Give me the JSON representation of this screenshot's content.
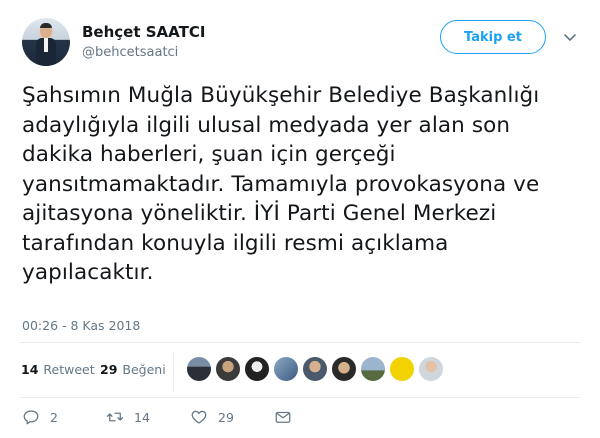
{
  "user": {
    "display_name": "Behçet SAATCI",
    "handle": "@behcetsaatci"
  },
  "follow_button": {
    "label": "Takip et"
  },
  "menu": {
    "icon": "chevron-down-icon"
  },
  "tweet": {
    "text": "Şahsımın Muğla Büyükşehir Belediye Başkanlığı adaylığıyla ilgili ulusal medyada yer alan son dakika haberleri, şuan için gerçeği yansıtmamaktadır. Tamamıyla provokasyona ve ajitasyona yöneliktir. İYİ Parti Genel Merkezi tarafından konuyla ilgili resmi açıklama yapılacaktır.",
    "timestamp": "00:26 - 8 Kas 2018"
  },
  "stats": {
    "retweet_count": "14",
    "retweet_label": "Retweet",
    "like_count": "29",
    "like_label": "Beğeni"
  },
  "actions": {
    "reply_count": "2",
    "retweet_count": "14",
    "like_count": "29"
  },
  "colors": {
    "accent": "#1da1f2",
    "secondary_text": "#657786",
    "primary_text": "#14171a",
    "divider": "#e6ecf0"
  }
}
